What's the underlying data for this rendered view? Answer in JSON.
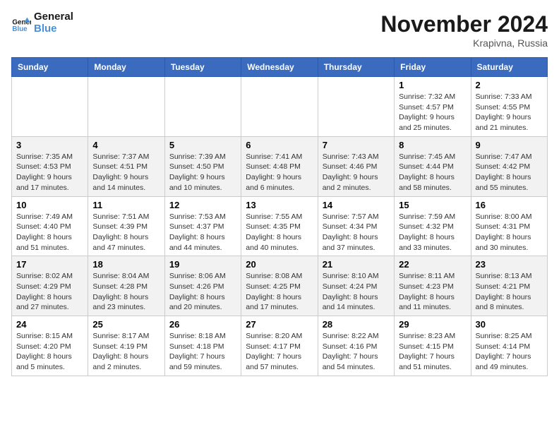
{
  "header": {
    "logo_line1": "General",
    "logo_line2": "Blue",
    "month": "November 2024",
    "location": "Krapivna, Russia"
  },
  "weekdays": [
    "Sunday",
    "Monday",
    "Tuesday",
    "Wednesday",
    "Thursday",
    "Friday",
    "Saturday"
  ],
  "weeks": [
    [
      {
        "day": "",
        "info": ""
      },
      {
        "day": "",
        "info": ""
      },
      {
        "day": "",
        "info": ""
      },
      {
        "day": "",
        "info": ""
      },
      {
        "day": "",
        "info": ""
      },
      {
        "day": "1",
        "info": "Sunrise: 7:32 AM\nSunset: 4:57 PM\nDaylight: 9 hours\nand 25 minutes."
      },
      {
        "day": "2",
        "info": "Sunrise: 7:33 AM\nSunset: 4:55 PM\nDaylight: 9 hours\nand 21 minutes."
      }
    ],
    [
      {
        "day": "3",
        "info": "Sunrise: 7:35 AM\nSunset: 4:53 PM\nDaylight: 9 hours\nand 17 minutes."
      },
      {
        "day": "4",
        "info": "Sunrise: 7:37 AM\nSunset: 4:51 PM\nDaylight: 9 hours\nand 14 minutes."
      },
      {
        "day": "5",
        "info": "Sunrise: 7:39 AM\nSunset: 4:50 PM\nDaylight: 9 hours\nand 10 minutes."
      },
      {
        "day": "6",
        "info": "Sunrise: 7:41 AM\nSunset: 4:48 PM\nDaylight: 9 hours\nand 6 minutes."
      },
      {
        "day": "7",
        "info": "Sunrise: 7:43 AM\nSunset: 4:46 PM\nDaylight: 9 hours\nand 2 minutes."
      },
      {
        "day": "8",
        "info": "Sunrise: 7:45 AM\nSunset: 4:44 PM\nDaylight: 8 hours\nand 58 minutes."
      },
      {
        "day": "9",
        "info": "Sunrise: 7:47 AM\nSunset: 4:42 PM\nDaylight: 8 hours\nand 55 minutes."
      }
    ],
    [
      {
        "day": "10",
        "info": "Sunrise: 7:49 AM\nSunset: 4:40 PM\nDaylight: 8 hours\nand 51 minutes."
      },
      {
        "day": "11",
        "info": "Sunrise: 7:51 AM\nSunset: 4:39 PM\nDaylight: 8 hours\nand 47 minutes."
      },
      {
        "day": "12",
        "info": "Sunrise: 7:53 AM\nSunset: 4:37 PM\nDaylight: 8 hours\nand 44 minutes."
      },
      {
        "day": "13",
        "info": "Sunrise: 7:55 AM\nSunset: 4:35 PM\nDaylight: 8 hours\nand 40 minutes."
      },
      {
        "day": "14",
        "info": "Sunrise: 7:57 AM\nSunset: 4:34 PM\nDaylight: 8 hours\nand 37 minutes."
      },
      {
        "day": "15",
        "info": "Sunrise: 7:59 AM\nSunset: 4:32 PM\nDaylight: 8 hours\nand 33 minutes."
      },
      {
        "day": "16",
        "info": "Sunrise: 8:00 AM\nSunset: 4:31 PM\nDaylight: 8 hours\nand 30 minutes."
      }
    ],
    [
      {
        "day": "17",
        "info": "Sunrise: 8:02 AM\nSunset: 4:29 PM\nDaylight: 8 hours\nand 27 minutes."
      },
      {
        "day": "18",
        "info": "Sunrise: 8:04 AM\nSunset: 4:28 PM\nDaylight: 8 hours\nand 23 minutes."
      },
      {
        "day": "19",
        "info": "Sunrise: 8:06 AM\nSunset: 4:26 PM\nDaylight: 8 hours\nand 20 minutes."
      },
      {
        "day": "20",
        "info": "Sunrise: 8:08 AM\nSunset: 4:25 PM\nDaylight: 8 hours\nand 17 minutes."
      },
      {
        "day": "21",
        "info": "Sunrise: 8:10 AM\nSunset: 4:24 PM\nDaylight: 8 hours\nand 14 minutes."
      },
      {
        "day": "22",
        "info": "Sunrise: 8:11 AM\nSunset: 4:23 PM\nDaylight: 8 hours\nand 11 minutes."
      },
      {
        "day": "23",
        "info": "Sunrise: 8:13 AM\nSunset: 4:21 PM\nDaylight: 8 hours\nand 8 minutes."
      }
    ],
    [
      {
        "day": "24",
        "info": "Sunrise: 8:15 AM\nSunset: 4:20 PM\nDaylight: 8 hours\nand 5 minutes."
      },
      {
        "day": "25",
        "info": "Sunrise: 8:17 AM\nSunset: 4:19 PM\nDaylight: 8 hours\nand 2 minutes."
      },
      {
        "day": "26",
        "info": "Sunrise: 8:18 AM\nSunset: 4:18 PM\nDaylight: 7 hours\nand 59 minutes."
      },
      {
        "day": "27",
        "info": "Sunrise: 8:20 AM\nSunset: 4:17 PM\nDaylight: 7 hours\nand 57 minutes."
      },
      {
        "day": "28",
        "info": "Sunrise: 8:22 AM\nSunset: 4:16 PM\nDaylight: 7 hours\nand 54 minutes."
      },
      {
        "day": "29",
        "info": "Sunrise: 8:23 AM\nSunset: 4:15 PM\nDaylight: 7 hours\nand 51 minutes."
      },
      {
        "day": "30",
        "info": "Sunrise: 8:25 AM\nSunset: 4:14 PM\nDaylight: 7 hours\nand 49 minutes."
      }
    ]
  ]
}
